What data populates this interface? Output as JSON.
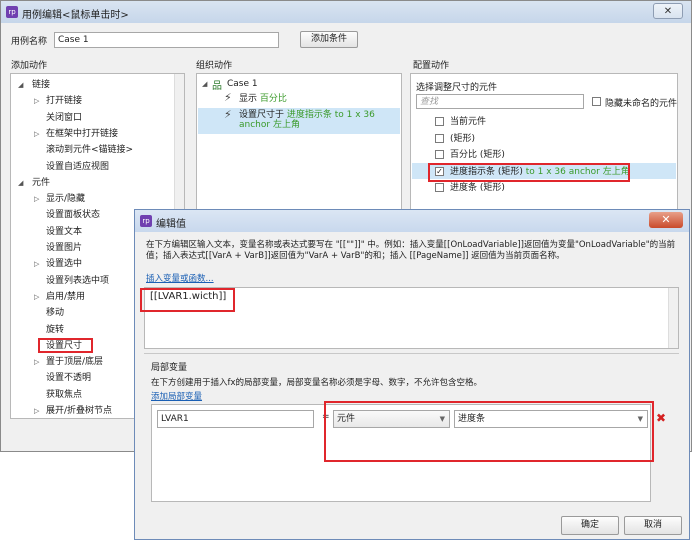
{
  "case_editor": {
    "title": "用例编辑<鼠标单击时>",
    "close_glyph": "✕",
    "case_name_label": "用例名称",
    "case_name_value": "Case 1",
    "add_condition": "添加条件",
    "add_action_header": "添加动作",
    "organize_action_header": "组织动作",
    "configure_action_header": "配置动作",
    "actions_tree": [
      {
        "label": "链接",
        "level": 0,
        "expanded": true
      },
      {
        "label": "打开链接",
        "level": 1,
        "expandable": true
      },
      {
        "label": "关闭窗口",
        "level": 1
      },
      {
        "label": "在框架中打开链接",
        "level": 1,
        "expandable": true
      },
      {
        "label": "滚动到元件<锚链接>",
        "level": 1
      },
      {
        "label": "设置自适应视图",
        "level": 1
      },
      {
        "label": "元件",
        "level": 0,
        "expanded": true
      },
      {
        "label": "显示/隐藏",
        "level": 1,
        "expandable": true
      },
      {
        "label": "设置面板状态",
        "level": 1
      },
      {
        "label": "设置文本",
        "level": 1
      },
      {
        "label": "设置图片",
        "level": 1
      },
      {
        "label": "设置选中",
        "level": 1,
        "expandable": true
      },
      {
        "label": "设置列表选中项",
        "level": 1
      },
      {
        "label": "启用/禁用",
        "level": 1,
        "expandable": true
      },
      {
        "label": "移动",
        "level": 1
      },
      {
        "label": "旋转",
        "level": 1
      },
      {
        "label": "设置尺寸",
        "level": 1
      },
      {
        "label": "置于顶层/底层",
        "level": 1,
        "expandable": true
      },
      {
        "label": "设置不透明",
        "level": 1
      },
      {
        "label": "获取焦点",
        "level": 1
      },
      {
        "label": "展开/折叠树节点",
        "level": 1,
        "expandable": true
      }
    ],
    "organize": {
      "case_label": "Case 1",
      "action1_prefix": "显示",
      "action1_target": "百分比",
      "action2_prefix": "设置尺寸于",
      "action2_target": "进度指示条 to 1 x 36 anchor 左上角"
    },
    "configure": {
      "title": "选择调整尺寸的元件",
      "search_placeholder": "查找",
      "hide_unnamed_label": "隐藏未命名的元件",
      "widgets": [
        {
          "label": "当前元件",
          "checked": false
        },
        {
          "label": "(矩形)",
          "checked": false
        },
        {
          "label": "百分比 (矩形)",
          "checked": false
        },
        {
          "label": "进度指示条 (矩形)",
          "suffix": "to 1 x 36 anchor 左上角",
          "checked": true
        },
        {
          "label": "进度条 (矩形)",
          "checked": false
        }
      ]
    }
  },
  "edit_value_dialog": {
    "title": "编辑值",
    "close_glyph": "✕",
    "description": "在下方编辑区输入文本，变量名称或表达式要写在 \"[[\"\"]]\" 中。例如：插入变量[[OnLoadVariable]]返回值为变量\"OnLoadVariable\"的当前值；插入表达式[[VarA + VarB]]返回值为\"VarA + VarB\"的和；插入 [[PageName]] 返回值为当前页面名称。",
    "insert_link": "插入变量或函数...",
    "expression": "[[LVAR1.wicth]]",
    "local_var_header": "局部变量",
    "local_var_desc": "在下方创建用于插入fx的局部变量，局部变量名称必须是字母、数字，不允许包含空格。",
    "add_local_var_link": "添加局部变量",
    "local_vars": [
      {
        "name": "LVAR1",
        "type": "元件",
        "target": "进度条"
      }
    ],
    "ok": "确定",
    "cancel": "取消"
  }
}
